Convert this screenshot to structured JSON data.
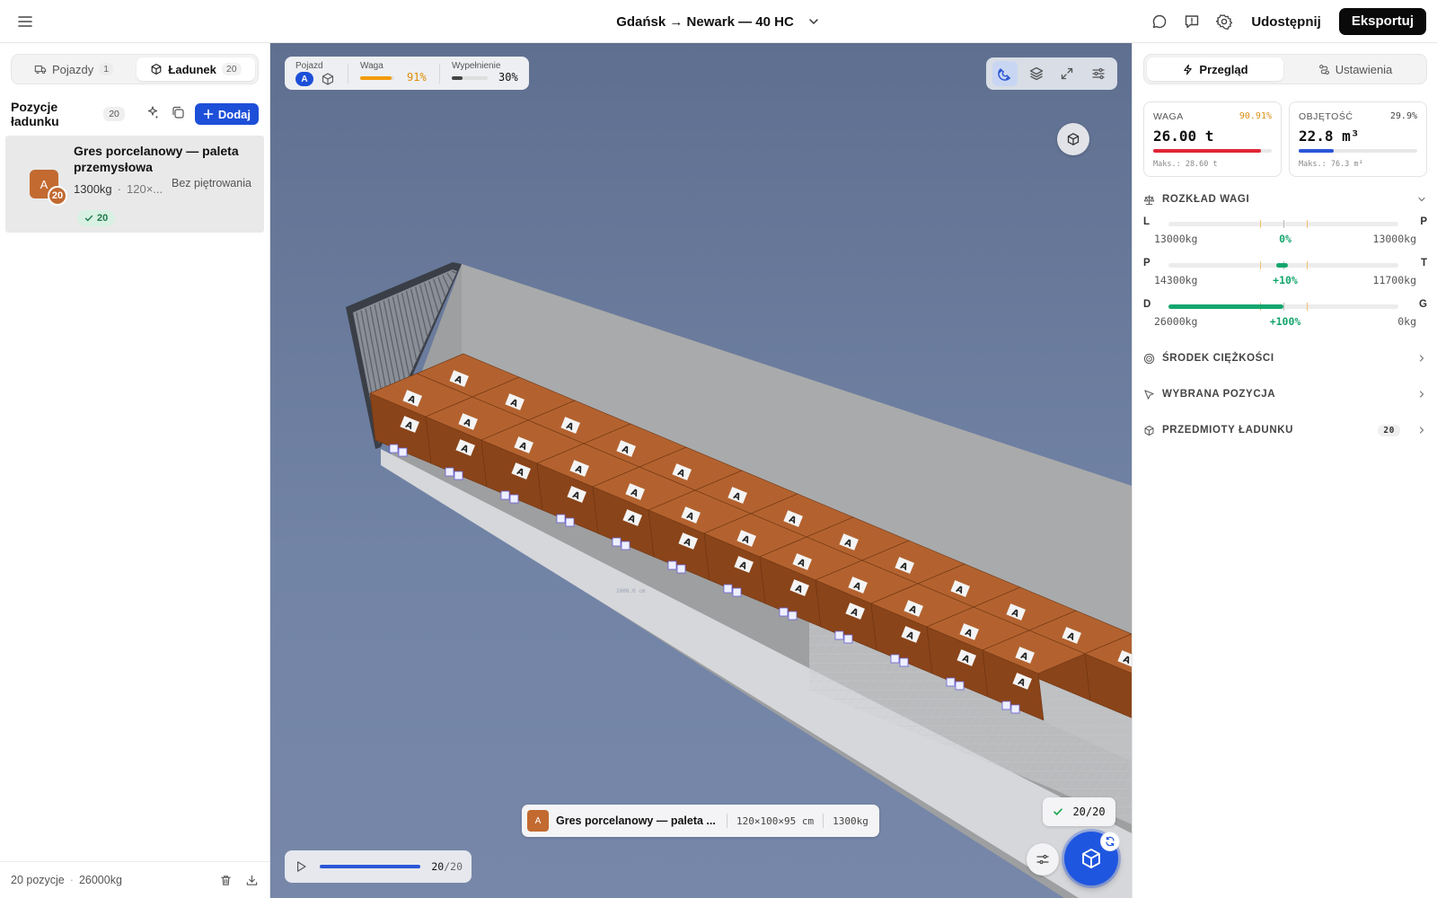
{
  "topbar": {
    "title": "Gdańsk → Newark — 40 HC",
    "share_label": "Udostępnij",
    "export_label": "Eksportuj",
    "icons": [
      "menu-icon",
      "chevron-down-icon",
      "message-icon",
      "feedback-icon",
      "settings-icon"
    ]
  },
  "left": {
    "tabs": [
      {
        "label": "Pojazdy",
        "count": "1",
        "icon": "truck-icon",
        "active": false
      },
      {
        "label": "Ładunek",
        "count": "20",
        "icon": "package-icon",
        "active": true
      }
    ],
    "list_title": "Pozycje ładunku",
    "list_count": "20",
    "add_label": "Dodaj",
    "items": [
      {
        "letter": "A",
        "badge": "20",
        "name": "Gres porcelanowy — paleta przemysłowa",
        "weight": "1300kg",
        "dims_trunc": "120×...",
        "stack": "Bez piętrowania",
        "placed": "20",
        "color": "#c26a30"
      }
    ],
    "footer": {
      "positions": "20 pozycje",
      "total_weight": "26000kg"
    }
  },
  "viewport": {
    "hud": {
      "vehicle_label": "Pojazd",
      "vehicle_badge": "A",
      "weight_label": "Waga",
      "weight_value": "91%",
      "weight_fraction": 0.91,
      "fill_label": "Wypełnienie",
      "fill_value": "30%",
      "fill_fraction": 0.3
    },
    "tools": [
      "magnet-icon",
      "layers-icon",
      "expand-icon",
      "sliders-icon"
    ],
    "info": {
      "letter": "A",
      "name": "Gres porcelanowy — paleta ...",
      "dims": "120×100×95 cm",
      "weight": "1300kg"
    },
    "placed_count": "20/20",
    "player": {
      "current": "20",
      "total": "/20",
      "progress": 1.0
    },
    "box_letter": "A",
    "colors": {
      "box_top": "#b3622f",
      "box_front": "#8a4419",
      "box_side": "#a35622",
      "accent": "#1f56e0"
    }
  },
  "right": {
    "tabs": [
      {
        "label": "Przegląd",
        "icon": "zap-icon",
        "active": true
      },
      {
        "label": "Ustawienia",
        "icon": "settings-flow-icon",
        "active": false
      }
    ],
    "weight_card": {
      "label": "WAGA",
      "pct": "90.91%",
      "value": "26.00 t",
      "max": "Maks.: 28.60 t",
      "fraction": 0.9091,
      "color": "#e02636",
      "pct_color": "#d99016"
    },
    "volume_card": {
      "label": "OBJĘTOŚĆ",
      "pct": "29.9%",
      "value": "22.8 m³",
      "max": "Maks.: 76.3 m³",
      "fraction": 0.299,
      "color": "#2a56d6"
    },
    "weight_dist": {
      "title": "ROZKŁAD WAGI",
      "rows": [
        {
          "left": "L",
          "right": "P",
          "lv": "13000kg",
          "cv": "0%",
          "rv": "13000kg"
        },
        {
          "left": "P",
          "right": "T",
          "lv": "14300kg",
          "cv": "+10%",
          "rv": "11700kg"
        },
        {
          "left": "D",
          "right": "G",
          "lv": "26000kg",
          "cv": "+100%",
          "rv": "0kg"
        }
      ]
    },
    "sections": [
      {
        "title": "ŚRODEK CIĘŻKOŚCI",
        "icon": "target-icon"
      },
      {
        "title": "WYBRANA POZYCJA",
        "icon": "cursor-icon"
      },
      {
        "title": "PRZEDMIOTY ŁADUNKU",
        "icon": "package-icon",
        "badge": "20"
      }
    ]
  }
}
